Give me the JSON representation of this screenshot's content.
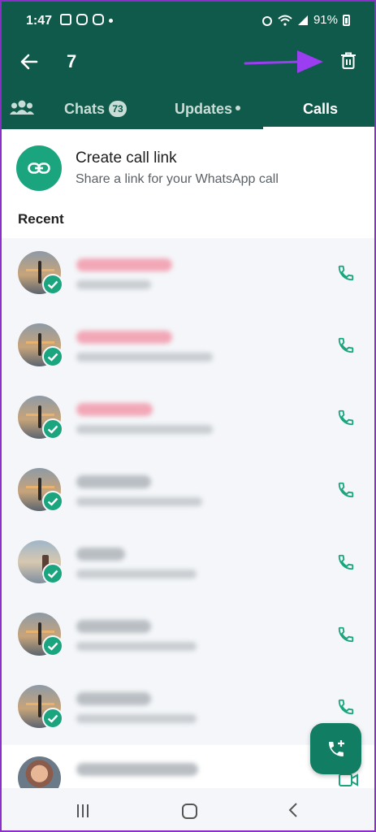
{
  "status_bar": {
    "time": "1:47",
    "battery": "91%"
  },
  "toolbar": {
    "selected_count": "7"
  },
  "tabs": [
    {
      "label": "Chats",
      "badge": "73"
    },
    {
      "label": "Updates"
    },
    {
      "label": "Calls"
    }
  ],
  "call_link": {
    "title": "Create call link",
    "subtitle": "Share a link for your WhatsApp call"
  },
  "recent_label": "Recent",
  "colors": {
    "header": "#0f5a4a",
    "accent": "#1aa57f",
    "annotation_arrow": "#9b3df0"
  },
  "icons": {
    "back": "arrow-left-icon",
    "delete": "trash-icon",
    "community": "community-icon",
    "link": "link-icon",
    "call": "phone-icon",
    "video": "video-icon",
    "new_call": "add-call-icon",
    "selected": "check-icon"
  }
}
